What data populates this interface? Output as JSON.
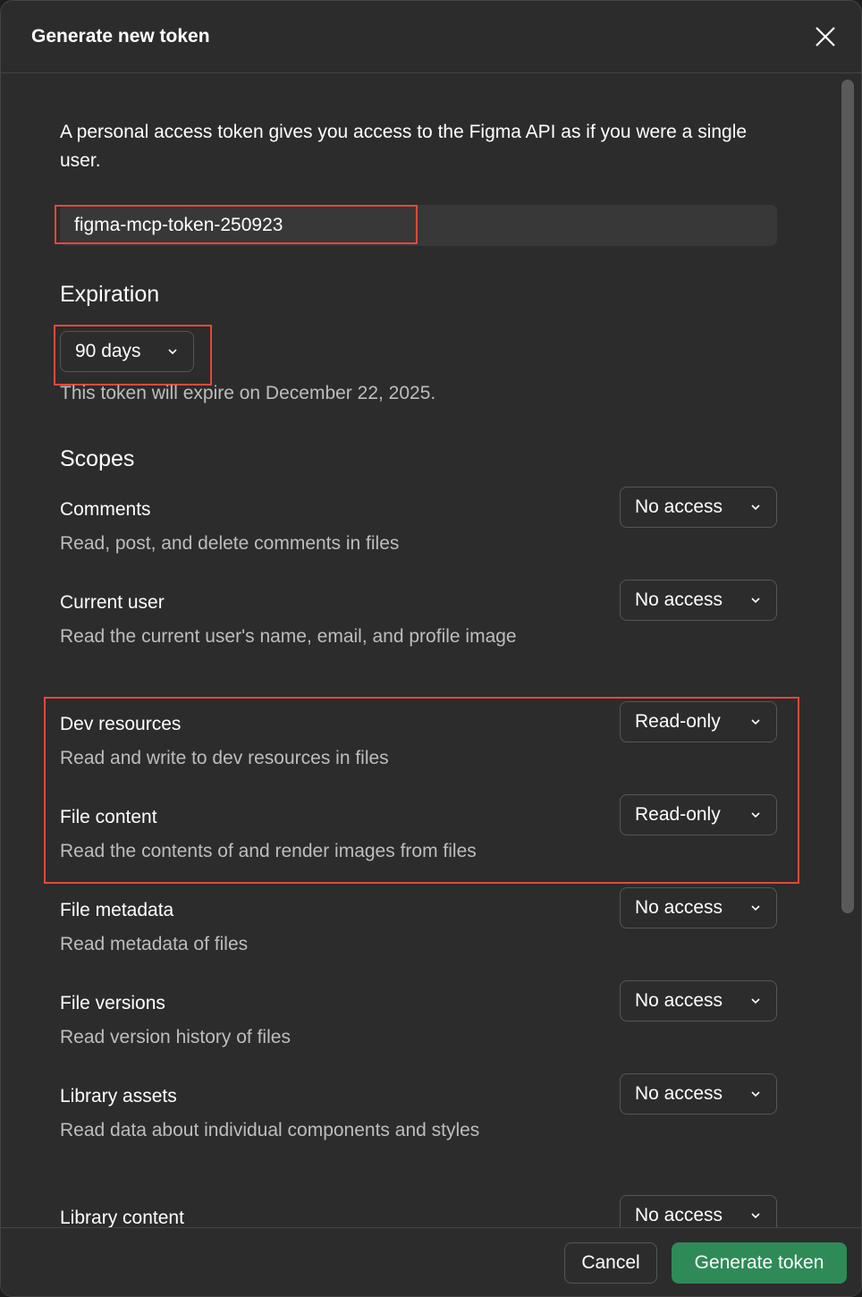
{
  "dialog": {
    "title": "Generate new token",
    "intro": "A personal access token gives you access to the Figma API as if you were a single user.",
    "token_name": "figma-mcp-token-250923"
  },
  "expiration": {
    "heading": "Expiration",
    "selected": "90 days",
    "note": "This token will expire on December 22, 2025."
  },
  "scopes": {
    "heading": "Scopes",
    "items": [
      {
        "name": "Comments",
        "desc": "Read, post, and delete comments in files",
        "value": "No access"
      },
      {
        "name": "Current user",
        "desc": "Read the current user's name, email, and profile image",
        "value": "No access"
      },
      {
        "name": "Dev resources",
        "desc": "Read and write to dev resources in files",
        "value": "Read-only"
      },
      {
        "name": "File content",
        "desc": "Read the contents of and render images from files",
        "value": "Read-only"
      },
      {
        "name": "File metadata",
        "desc": "Read metadata of files",
        "value": "No access"
      },
      {
        "name": "File versions",
        "desc": "Read version history of files",
        "value": "No access"
      },
      {
        "name": "Library assets",
        "desc": "Read data about individual components and styles",
        "value": "No access"
      },
      {
        "name": "Library content",
        "desc": "",
        "value": "No access"
      }
    ]
  },
  "footer": {
    "cancel_label": "Cancel",
    "generate_label": "Generate token"
  },
  "colors": {
    "highlight": "#e5483a",
    "primary_button": "#2e8b57",
    "background": "#2c2c2c"
  }
}
